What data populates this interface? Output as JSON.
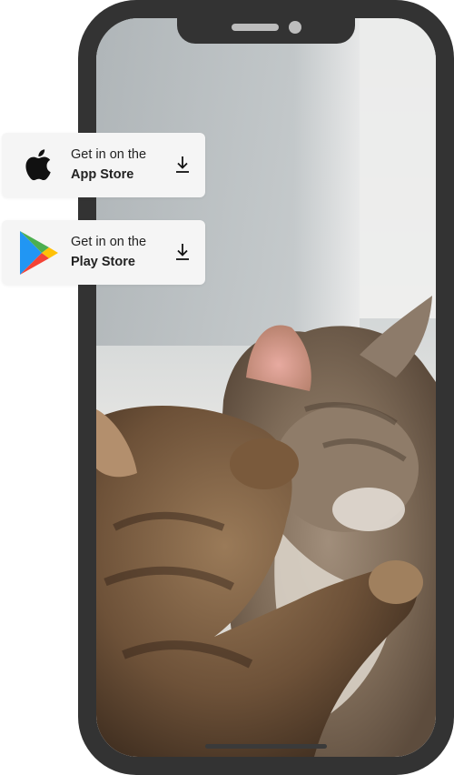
{
  "badges": {
    "app_store": {
      "line1": "Get in on the",
      "line2": "App Store",
      "icon": "apple-icon",
      "action_icon": "download-icon"
    },
    "play_store": {
      "line1": "Get in on the",
      "line2": "Play Store",
      "icon": "google-play-icon",
      "action_icon": "download-icon"
    }
  },
  "colors": {
    "phone_frame": "#333333",
    "badge_bg": "#f5f5f5",
    "text": "#222222"
  }
}
